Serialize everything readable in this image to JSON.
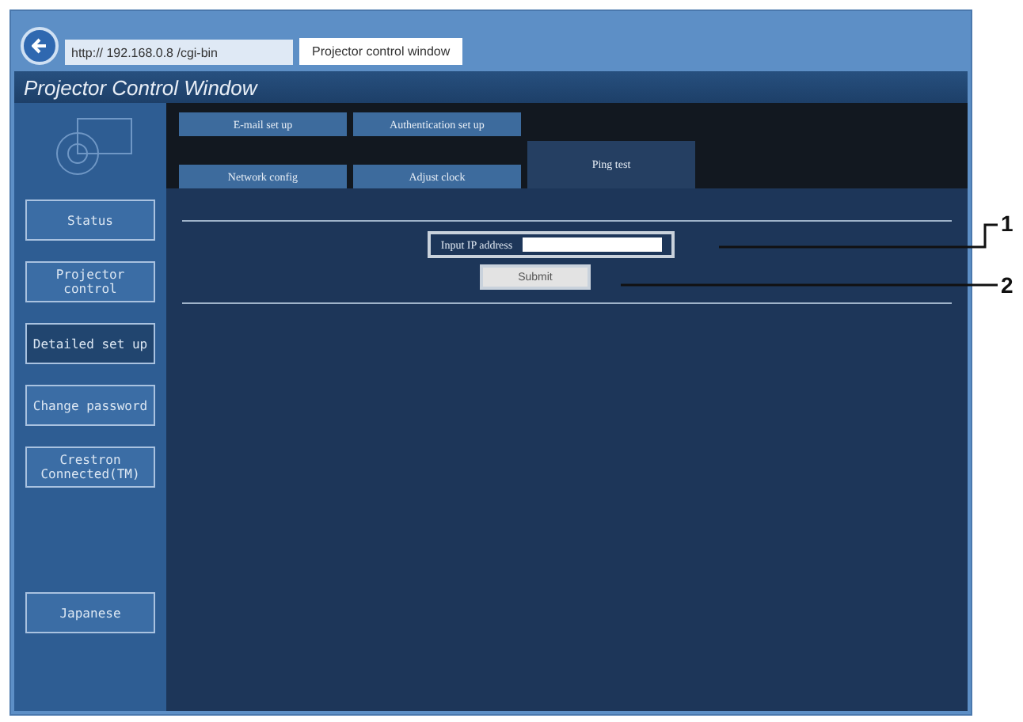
{
  "browser": {
    "address": "http:// 192.168.0.8 /cgi-bin",
    "tab_title": "Projector control window"
  },
  "window": {
    "title": "Projector Control Window"
  },
  "sidebar": {
    "items": [
      {
        "label": "Status",
        "selected": false
      },
      {
        "label": "Projector control",
        "selected": false
      },
      {
        "label": "Detailed set up",
        "selected": true
      },
      {
        "label": "Change password",
        "selected": false
      },
      {
        "label": "Crestron Connected(TM)",
        "selected": false
      }
    ],
    "language_button": "Japanese"
  },
  "tabs": [
    [
      {
        "label": "E-mail set up",
        "selected": false
      },
      {
        "label": "Authentication set up",
        "selected": false
      }
    ],
    [
      {
        "label": "Network config",
        "selected": false
      },
      {
        "label": "Adjust clock",
        "selected": false
      },
      {
        "label": "Ping test",
        "selected": true
      }
    ]
  ],
  "form": {
    "label": "Input IP address",
    "submit": "Submit"
  },
  "callouts": [
    "1",
    "2"
  ]
}
